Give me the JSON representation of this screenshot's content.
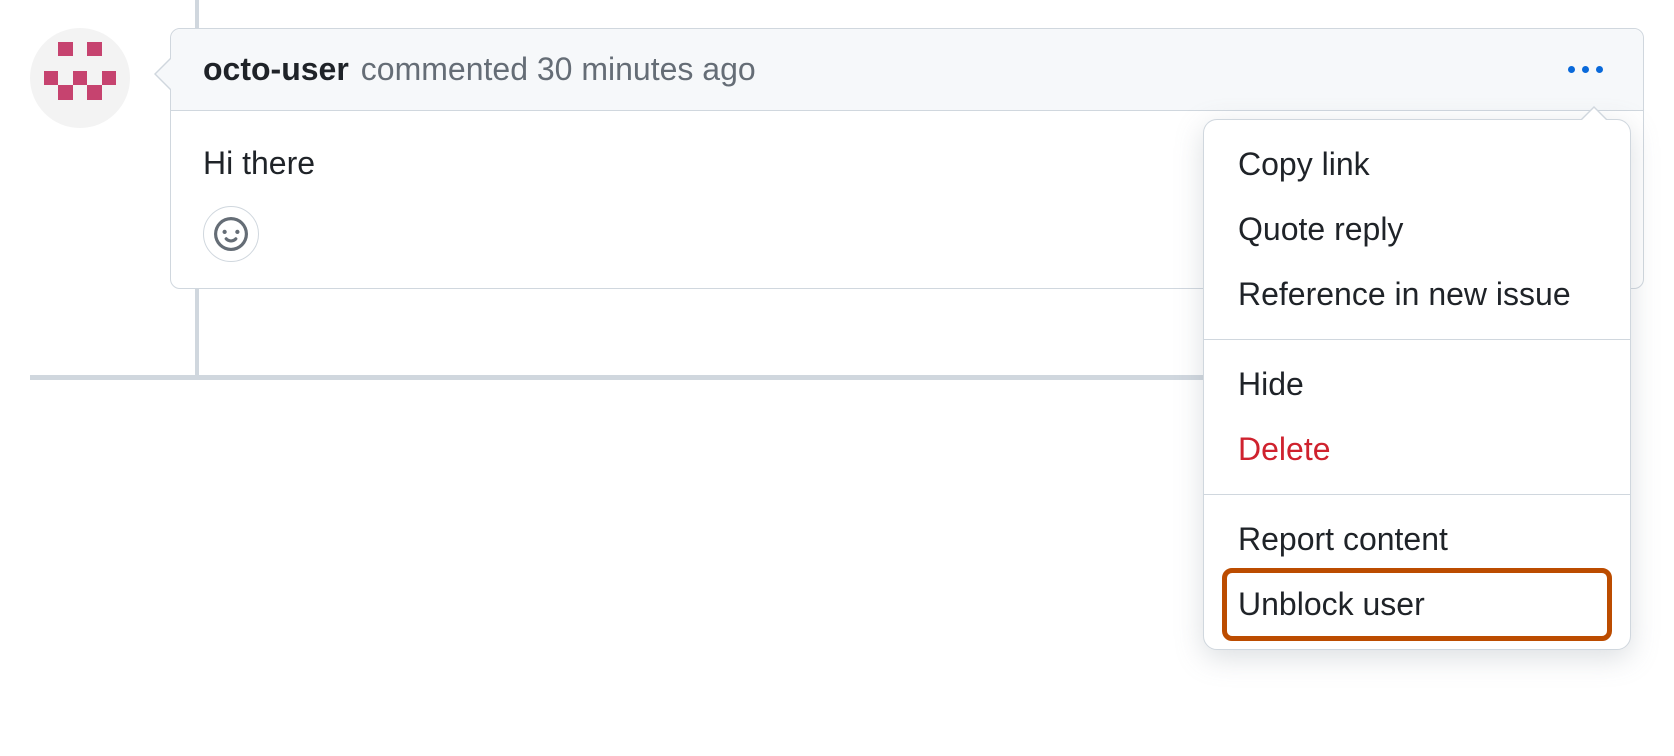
{
  "comment": {
    "author": "octo-user",
    "meta_text": "commented 30 minutes ago",
    "body": "Hi there"
  },
  "menu": {
    "copy_link": "Copy link",
    "quote_reply": "Quote reply",
    "reference_issue": "Reference in new issue",
    "hide": "Hide",
    "delete": "Delete",
    "report_content": "Report content",
    "unblock_user": "Unblock user"
  }
}
